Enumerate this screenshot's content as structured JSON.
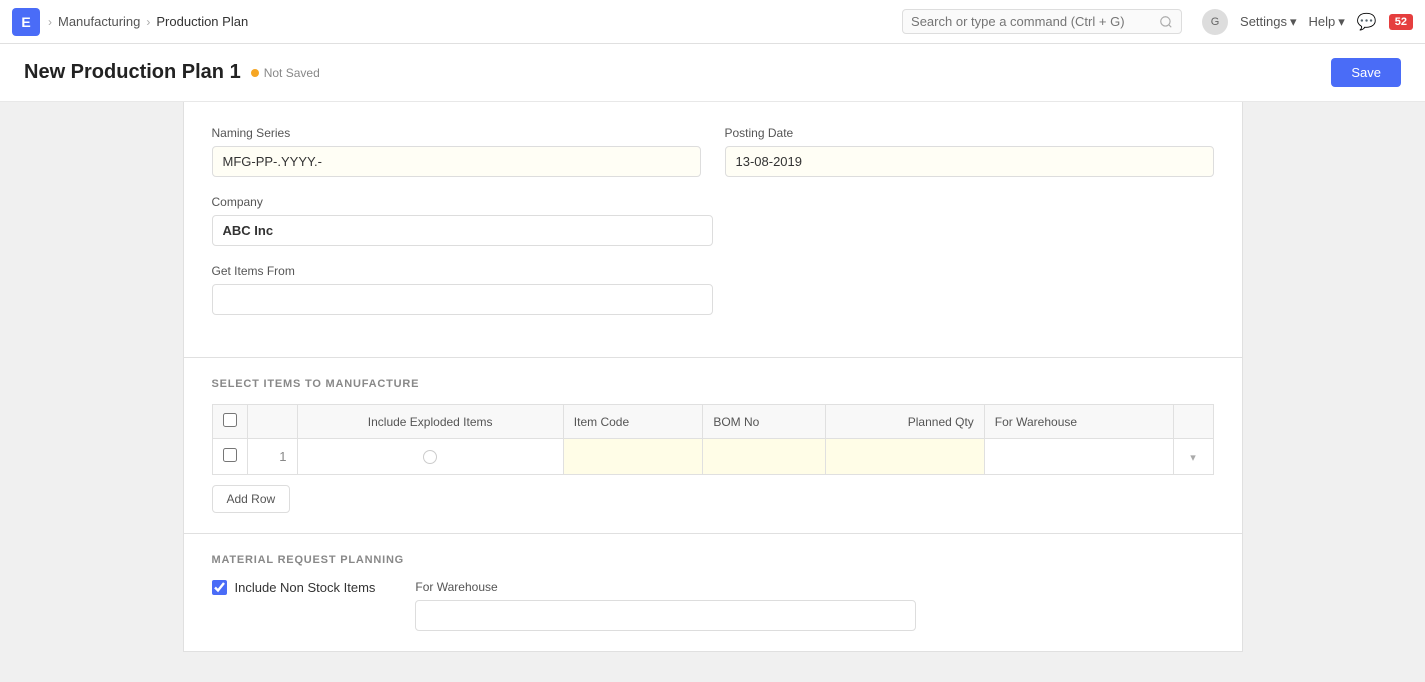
{
  "navbar": {
    "brand_letter": "E",
    "breadcrumbs": [
      {
        "label": "Manufacturing",
        "current": false
      },
      {
        "label": "Production Plan",
        "current": true
      }
    ],
    "search_placeholder": "Search or type a command (Ctrl + G)",
    "avatar_initial": "G",
    "settings_label": "Settings",
    "help_label": "Help",
    "notification_count": "52"
  },
  "page": {
    "title": "New Production Plan 1",
    "status": "Not Saved",
    "save_label": "Save"
  },
  "form": {
    "naming_series_label": "Naming Series",
    "naming_series_value": "MFG-PP-.YYYY.-",
    "posting_date_label": "Posting Date",
    "posting_date_value": "13-08-2019",
    "company_label": "Company",
    "company_value": "ABC Inc",
    "get_items_from_label": "Get Items From",
    "get_items_from_value": ""
  },
  "select_items_section": {
    "header": "SELECT ITEMS TO MANUFACTURE",
    "table": {
      "columns": [
        {
          "label": "",
          "type": "checkbox"
        },
        {
          "label": "",
          "type": "rownum"
        },
        {
          "label": "Include Exploded Items",
          "align": "center"
        },
        {
          "label": "Item Code"
        },
        {
          "label": "BOM No"
        },
        {
          "label": "Planned Qty",
          "align": "right"
        },
        {
          "label": "For Warehouse"
        },
        {
          "label": "",
          "type": "actions"
        }
      ],
      "rows": [
        {
          "checkbox": false,
          "num": "1",
          "include_exploded": "",
          "item_code": "",
          "bom_no": "",
          "planned_qty": "",
          "for_warehouse": "",
          "has_dropdown": true
        }
      ]
    },
    "add_row_label": "Add Row"
  },
  "material_request_section": {
    "header": "MATERIAL REQUEST PLANNING",
    "include_non_stock_label": "Include Non Stock Items",
    "include_non_stock_checked": true,
    "for_warehouse_label": "For Warehouse",
    "for_warehouse_value": ""
  }
}
